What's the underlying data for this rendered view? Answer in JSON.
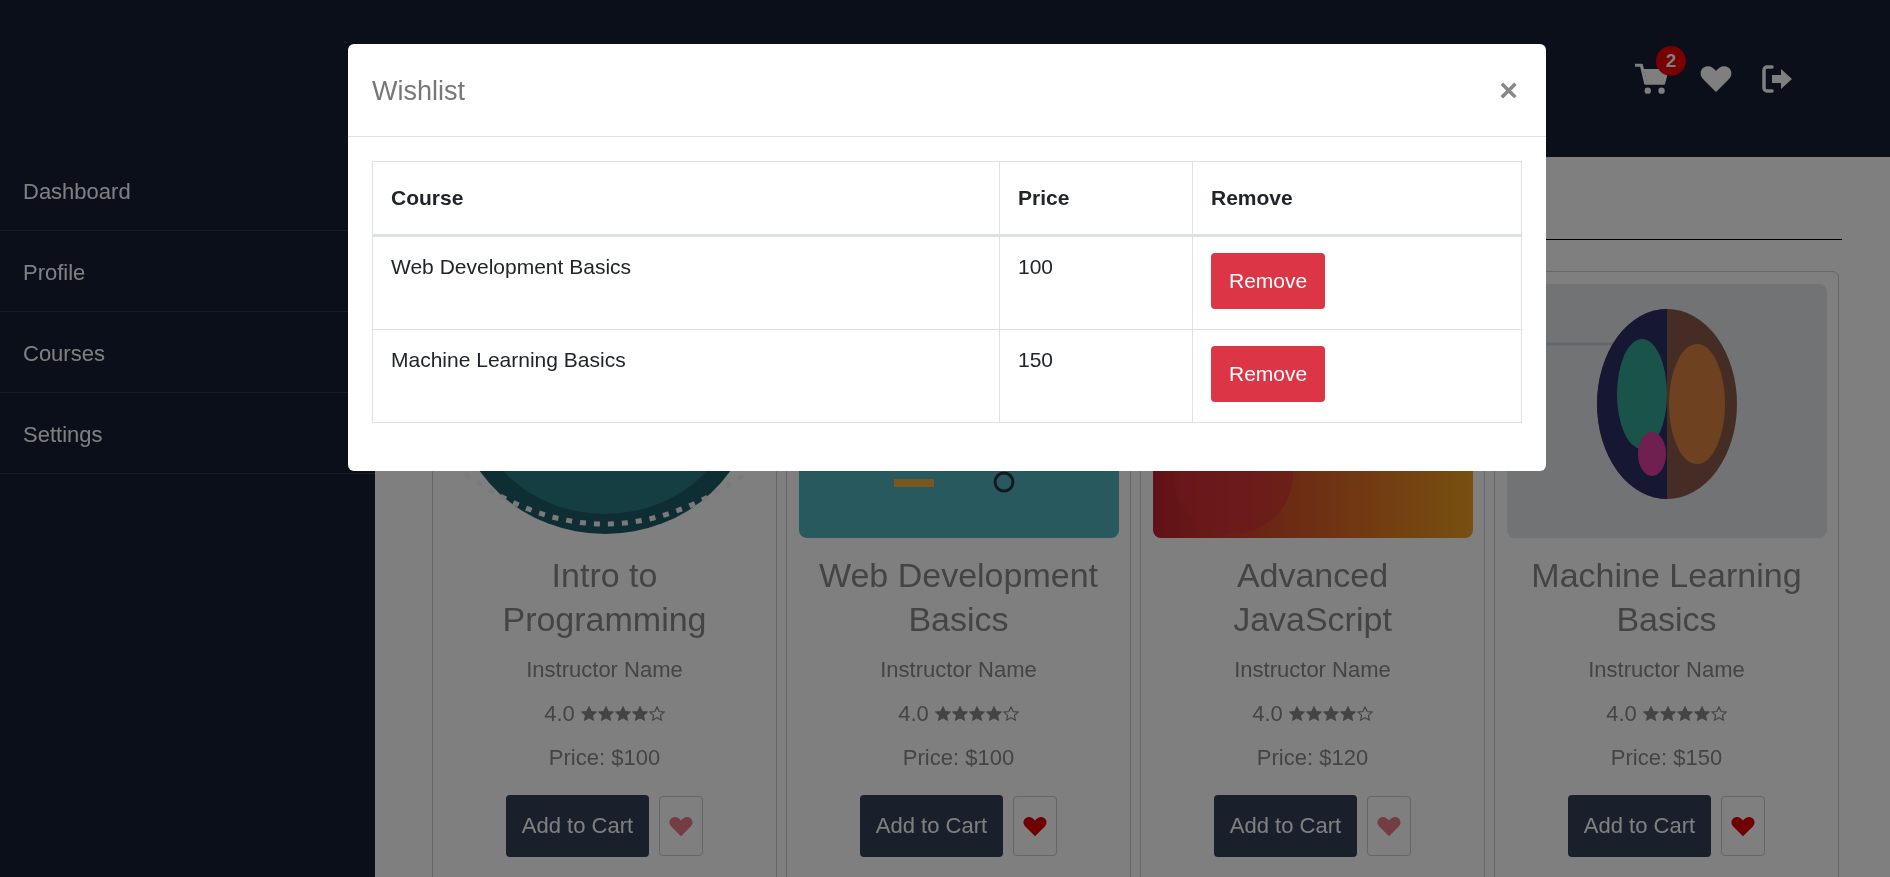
{
  "header": {
    "cart_count": "2"
  },
  "sidebar": {
    "items": [
      {
        "label": "Dashboard"
      },
      {
        "label": "Profile"
      },
      {
        "label": "Courses"
      },
      {
        "label": "Settings"
      }
    ]
  },
  "courses": [
    {
      "title": "Intro to Programming",
      "instructor": "Instructor Name",
      "rating": "4.0",
      "stars": 4,
      "price": "Price: $100",
      "button": "Add to Cart",
      "wishlisted": false
    },
    {
      "title": "Web Development Basics",
      "instructor": "Instructor Name",
      "rating": "4.0",
      "stars": 4,
      "price": "Price: $100",
      "button": "Add to Cart",
      "wishlisted": true
    },
    {
      "title": "Advanced JavaScript",
      "instructor": "Instructor Name",
      "rating": "4.0",
      "stars": 4,
      "price": "Price: $120",
      "button": "Add to Cart",
      "wishlisted": false
    },
    {
      "title": "Machine Learning Basics",
      "instructor": "Instructor Name",
      "rating": "4.0",
      "stars": 4,
      "price": "Price: $150",
      "button": "Add to Cart",
      "wishlisted": true
    }
  ],
  "modal": {
    "title": "Wishlist",
    "close": "×",
    "table": {
      "columns": [
        "Course",
        "Price",
        "Remove"
      ],
      "rows": [
        {
          "course": "Web Development Basics",
          "price": "100",
          "action": "Remove"
        },
        {
          "course": "Machine Learning Basics",
          "price": "150",
          "action": "Remove"
        }
      ]
    }
  }
}
